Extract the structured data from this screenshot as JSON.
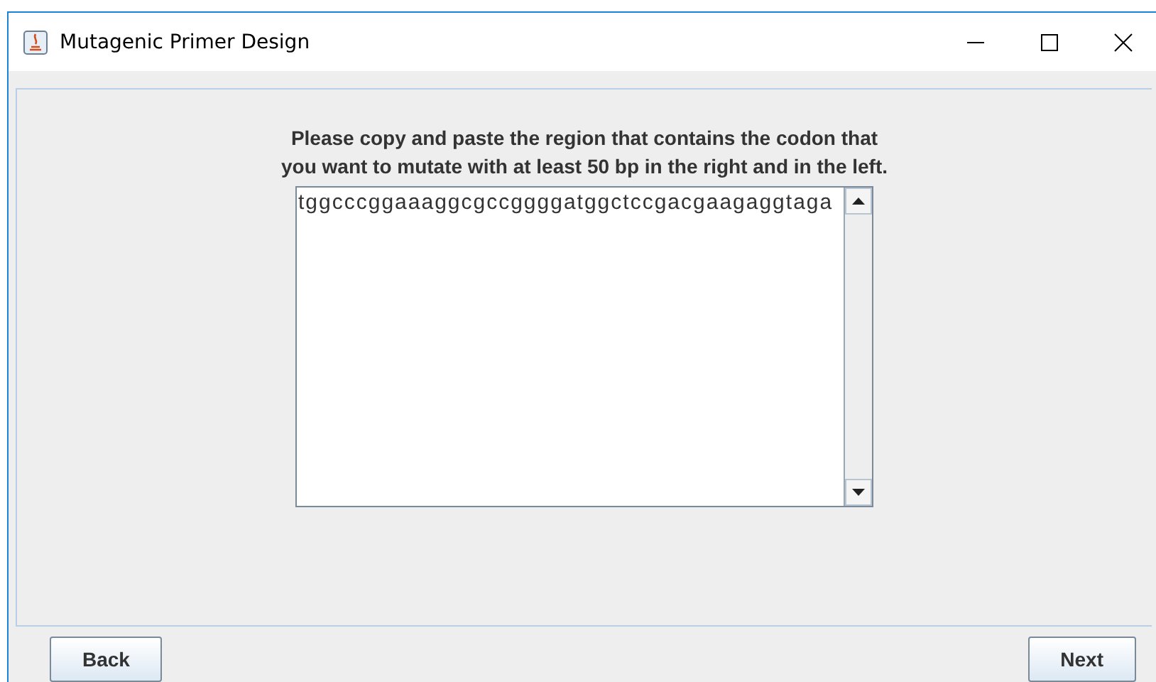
{
  "window": {
    "title": "Mutagenic Primer Design"
  },
  "instructions": [
    "Please copy and paste the region that contains the codon that",
    "you want to mutate with at least 50 bp in the right and in the left."
  ],
  "sequence_field": {
    "value": "tggcccggaaaggcgccggggatggctccgacgaagaggtaga"
  },
  "buttons": [
    {
      "label": "Back"
    },
    {
      "label": "Next"
    }
  ]
}
